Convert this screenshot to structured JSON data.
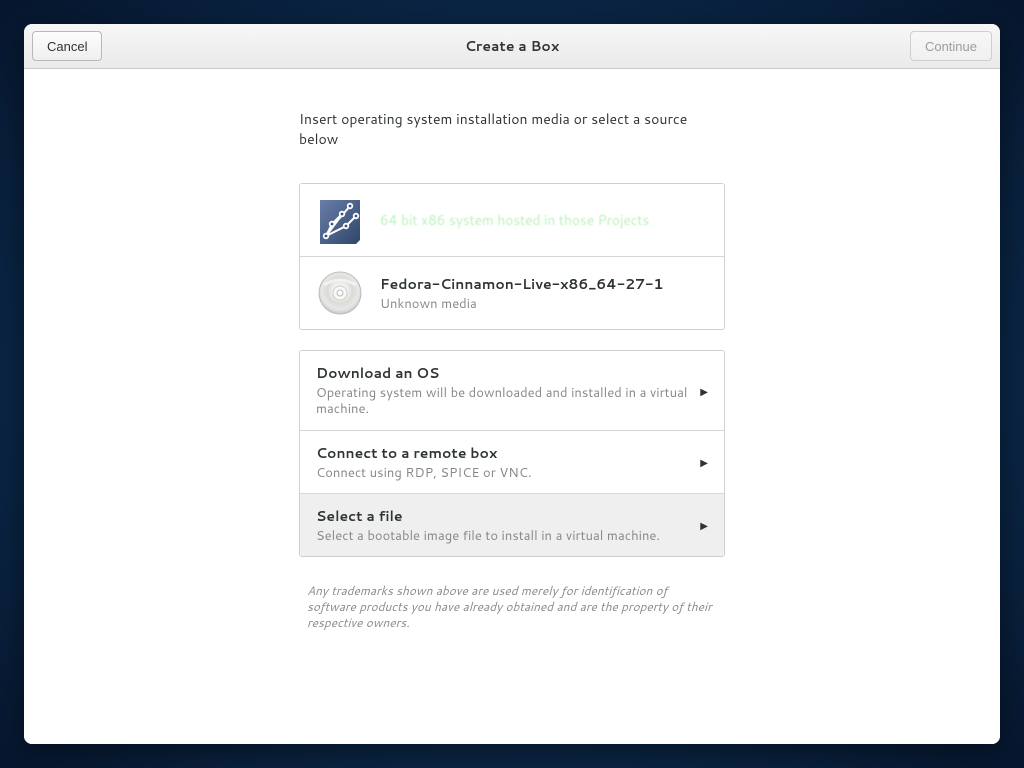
{
  "header": {
    "cancel": "Cancel",
    "title": "Create a Box",
    "continue": "Continue"
  },
  "intro": "Insert operating system installation media or select a source below",
  "detected": {
    "primary_label": "64 bit x86 system hosted in those Projects",
    "iso_title": "Fedora-Cinnamon-Live-x86_64-27-1",
    "iso_subtitle": "Unknown media"
  },
  "options": [
    {
      "id": "download",
      "title": "Download an OS",
      "subtitle": "Operating system will be downloaded and installed in a virtual machine."
    },
    {
      "id": "remote",
      "title": "Connect to a remote box",
      "subtitle": "Connect using RDP, SPICE or VNC."
    },
    {
      "id": "file",
      "title": "Select a file",
      "subtitle": "Select a bootable image file to install in a virtual machine."
    }
  ],
  "disclaimer": "Any trademarks shown above are used merely for identification of software products you have already obtained and are the property of their respective owners."
}
